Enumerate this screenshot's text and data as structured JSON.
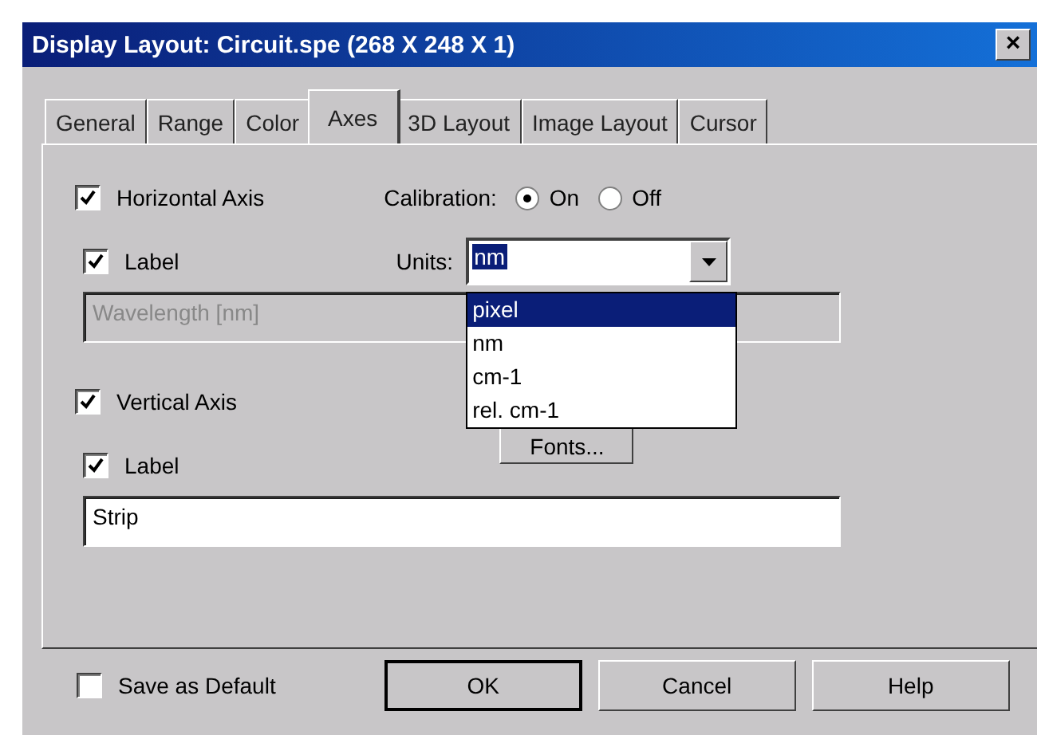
{
  "window": {
    "title": "Display Layout: Circuit.spe (268 X 248 X 1)",
    "close": "×"
  },
  "tabs": [
    {
      "label": "General",
      "selected": false
    },
    {
      "label": "Range",
      "selected": false
    },
    {
      "label": "Color",
      "selected": false
    },
    {
      "label": "Axes",
      "selected": true
    },
    {
      "label": "3D Layout",
      "selected": false
    },
    {
      "label": "Image Layout",
      "selected": false
    },
    {
      "label": "Cursor",
      "selected": false
    }
  ],
  "horizontal_axis": {
    "label": "Horizontal Axis",
    "checked": true,
    "label_checkbox": {
      "label": "Label",
      "checked": true
    },
    "label_field": {
      "value": "Wavelength [nm]",
      "disabled": true
    }
  },
  "calibration": {
    "label": "Calibration:",
    "options": [
      {
        "label": "On",
        "selected": true
      },
      {
        "label": "Off",
        "selected": false
      }
    ]
  },
  "units": {
    "label": "Units:",
    "value": "nm",
    "expanded": true,
    "options": [
      {
        "label": "pixel",
        "highlighted": true
      },
      {
        "label": "nm",
        "highlighted": false
      },
      {
        "label": "cm-1",
        "highlighted": false
      },
      {
        "label": "rel. cm-1",
        "highlighted": false
      }
    ]
  },
  "vertical_axis": {
    "label": "Vertical Axis",
    "checked": true,
    "label_checkbox": {
      "label": "Label",
      "checked": true
    },
    "label_field": {
      "value": "Strip",
      "disabled": false
    }
  },
  "fonts_button": "Fonts...",
  "save_as_default": {
    "label": "Save as Default",
    "checked": false
  },
  "buttons": [
    "OK",
    "Cancel",
    "Help"
  ]
}
